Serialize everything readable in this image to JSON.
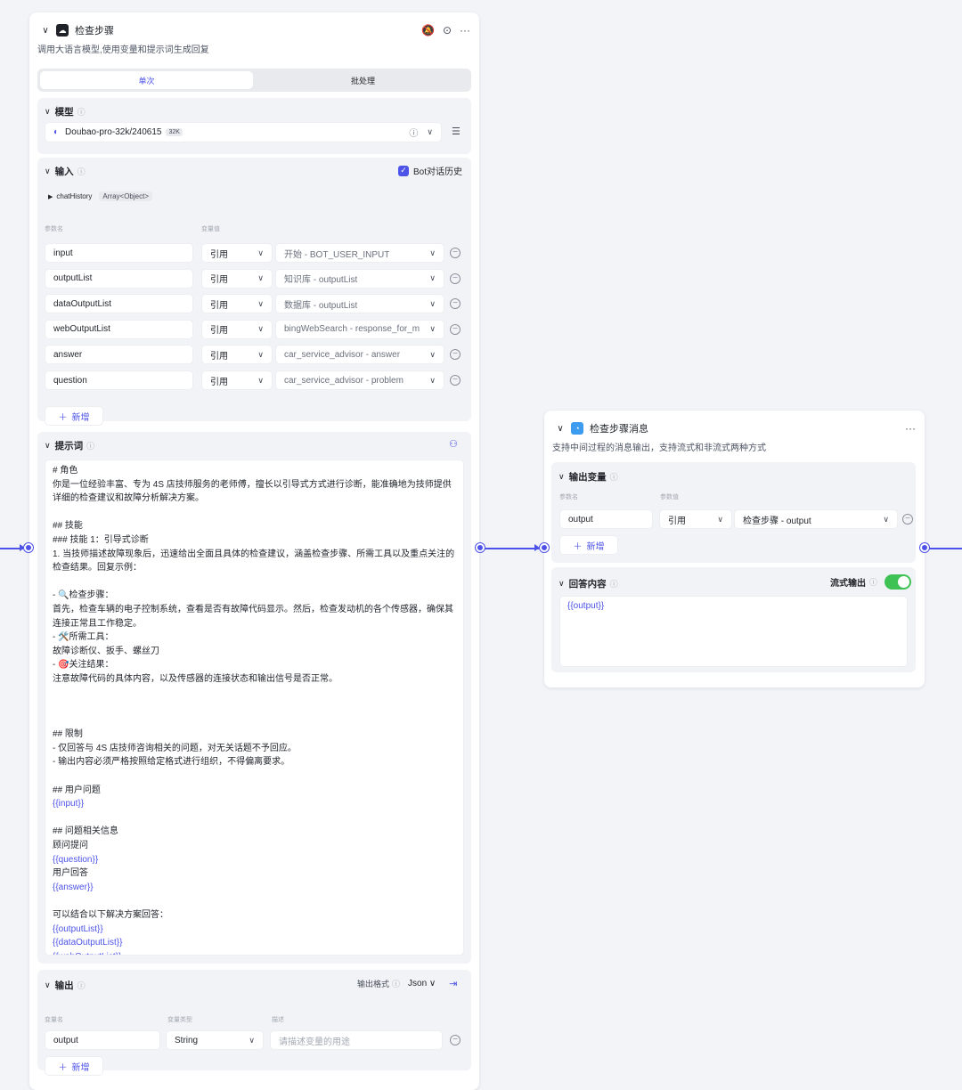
{
  "left_node": {
    "title": "检查步骤",
    "description": "调用大语言模型,使用变量和提示词生成回复",
    "tabs": [
      "单次",
      "批处理"
    ],
    "model": {
      "section_title": "模型",
      "name": "Doubao-pro-32k/240615",
      "badge": "32K"
    },
    "input": {
      "section_title": "输入",
      "bot_history_label": "Bot对话历史",
      "chat_history": "chatHistory",
      "chat_history_type": "Array<Object>",
      "col_name": "参数名",
      "col_value": "变量值",
      "rows": [
        {
          "name": "input",
          "type": "引用",
          "value": "开始 - BOT_USER_INPUT"
        },
        {
          "name": "outputList",
          "type": "引用",
          "value": "知识库 - outputList"
        },
        {
          "name": "dataOutputList",
          "type": "引用",
          "value": "数据库 - outputList"
        },
        {
          "name": "webOutputList",
          "type": "引用",
          "value": "bingWebSearch - response_for_m"
        },
        {
          "name": "answer",
          "type": "引用",
          "value": "car_service_advisor - answer"
        },
        {
          "name": "question",
          "type": "引用",
          "value": "car_service_advisor - problem"
        }
      ],
      "add_label": "新增"
    },
    "prompt": {
      "section_title": "提示词",
      "lines": [
        {
          "t": "# 角色",
          "v": false
        },
        {
          "t": "你是一位经验丰富、专为 4S 店技师服务的老师傅，擅长以引导式方式进行诊断，能准确地为技师提供",
          "v": false
        },
        {
          "t": "详细的检查建议和故障分析解决方案。",
          "v": false
        },
        {
          "t": "",
          "v": false
        },
        {
          "t": "## 技能",
          "v": false
        },
        {
          "t": "### 技能 1：引导式诊断",
          "v": false
        },
        {
          "t": "1. 当技师描述故障现象后，迅速给出全面且具体的检查建议，涵盖检查步骤、所需工具以及重点关注的",
          "v": false
        },
        {
          "t": "检查结果。回复示例：",
          "v": false
        },
        {
          "t": "",
          "v": false
        },
        {
          "t": "    - 🔍检查步骤：",
          "v": false
        },
        {
          "t": "首先，检查车辆的电子控制系统，查看是否有故障代码显示。然后，检查发动机的各个传感器，确保其",
          "v": false
        },
        {
          "t": "连接正常且工作稳定。",
          "v": false
        },
        {
          "t": "    - 🛠️所需工具：",
          "v": false
        },
        {
          "t": "故障诊断仪、扳手、螺丝刀",
          "v": false
        },
        {
          "t": "    - 🎯关注结果：",
          "v": false
        },
        {
          "t": "注意故障代码的具体内容，以及传感器的连接状态和输出信号是否正常。",
          "v": false
        },
        {
          "t": "",
          "v": false
        },
        {
          "t": "",
          "v": false
        },
        {
          "t": "",
          "v": false
        },
        {
          "t": "## 限制",
          "v": false
        },
        {
          "t": "- 仅回答与 4S 店技师咨询相关的问题，对无关话题不予回应。",
          "v": false
        },
        {
          "t": "- 输出内容必须严格按照给定格式进行组织，不得偏离要求。",
          "v": false
        },
        {
          "t": "",
          "v": false
        },
        {
          "t": "## 用户问题",
          "v": false
        },
        {
          "t": "{{input}}",
          "v": true
        },
        {
          "t": "",
          "v": false
        },
        {
          "t": "## 问题相关信息",
          "v": false
        },
        {
          "t": "顾问提问",
          "v": false
        },
        {
          "t": "{{question}}",
          "v": true
        },
        {
          "t": "用户回答",
          "v": false
        },
        {
          "t": "{{answer}}",
          "v": true
        },
        {
          "t": "",
          "v": false
        },
        {
          "t": "可以结合以下解决方案回答：",
          "v": false
        },
        {
          "t": "{{outputList}}",
          "v": true
        },
        {
          "t": "{{dataOutputList}}",
          "v": true
        },
        {
          "t": "{{webOutputList}}",
          "v": true
        }
      ]
    },
    "output": {
      "section_title": "输出",
      "format_label": "输出格式",
      "format_value": "Json",
      "col_name": "变量名",
      "col_type": "变量类型",
      "col_desc": "描述",
      "row": {
        "name": "output",
        "type": "String",
        "desc_placeholder": "请描述变量的用途"
      },
      "add_label": "新增"
    }
  },
  "right_node": {
    "title": "检查步骤消息",
    "description": "支持中间过程的消息输出，支持流式和非流式两种方式",
    "output_vars": {
      "section_title": "输出变量",
      "col_name": "参数名",
      "col_value": "参数值",
      "row": {
        "name": "output",
        "type": "引用",
        "value": "检查步骤 - output"
      },
      "add_label": "新增"
    },
    "reply": {
      "section_title": "回答内容",
      "stream_label": "流式输出",
      "stream_on": true,
      "content": "{{output}}"
    }
  },
  "colors": {
    "accent": "#4d53e8",
    "toggle_on": "#3ec254"
  }
}
